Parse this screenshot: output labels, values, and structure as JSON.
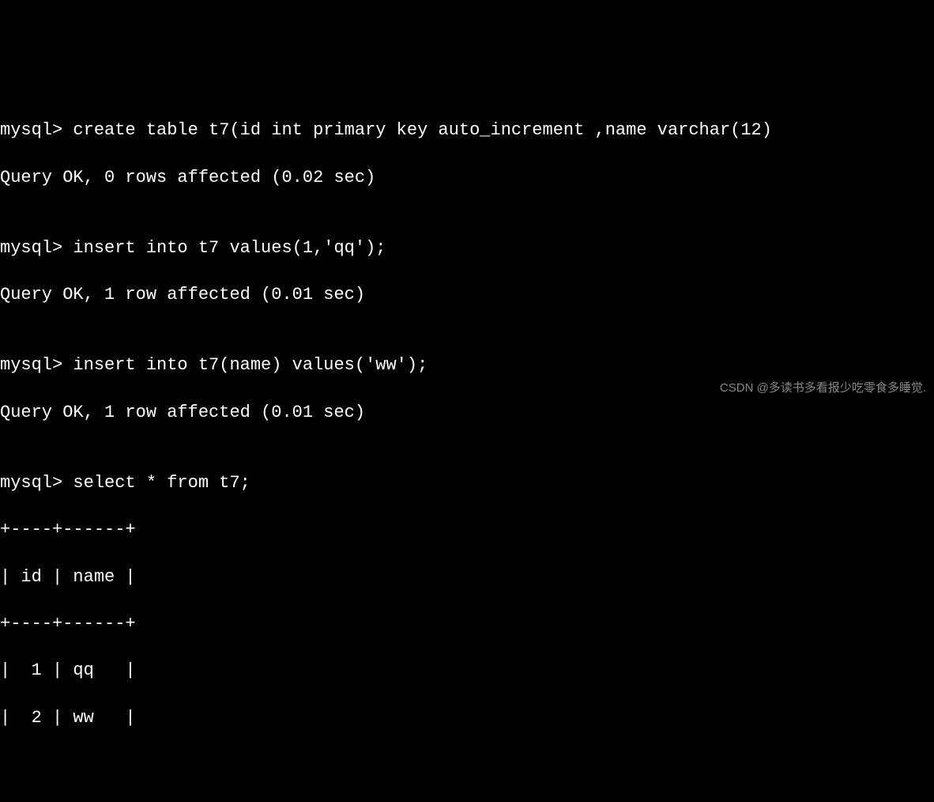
{
  "terminal": {
    "lines": [
      "mysql> create table t7(id int primary key auto_increment ,name varchar(12)",
      "Query OK, 0 rows affected (0.02 sec)",
      "",
      "mysql> insert into t7 values(1,'qq');",
      "Query OK, 1 row affected (0.01 sec)",
      "",
      "mysql> insert into t7(name) values('ww');",
      "Query OK, 1 row affected (0.01 sec)",
      "",
      "mysql> select * from t7;",
      "+----+------+",
      "| id | name |",
      "+----+------+",
      "|  1 | qq   |",
      "|  2 | ww   |"
    ]
  },
  "watermark": "CSDN @多读书多看报少吃零食多睡觉."
}
